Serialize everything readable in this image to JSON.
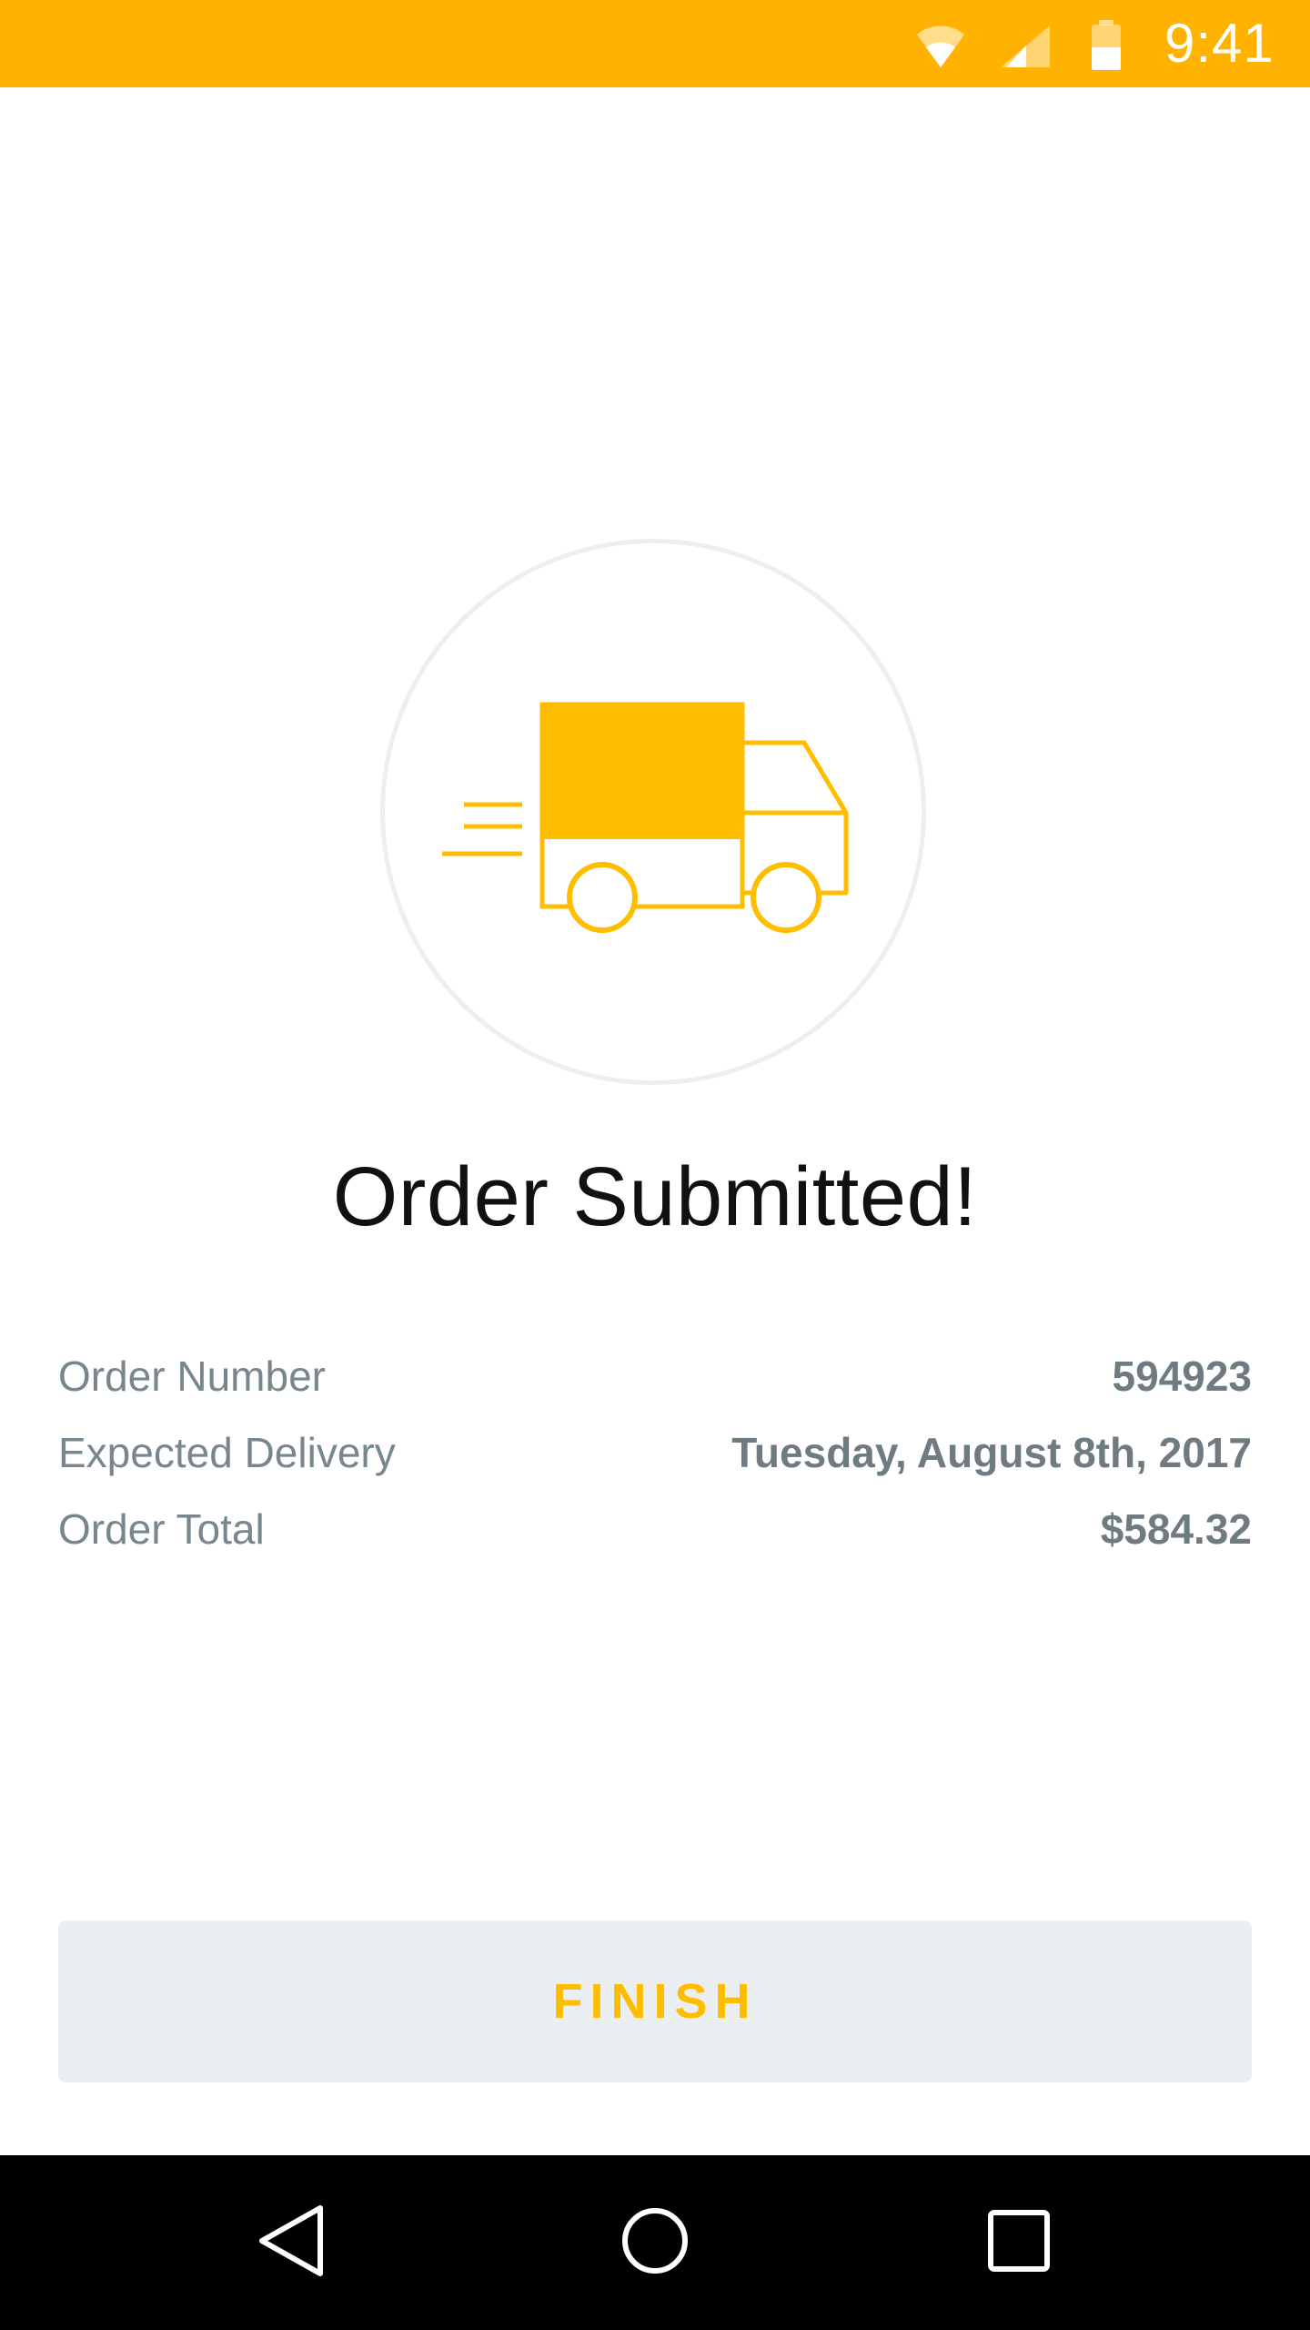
{
  "status_bar": {
    "time": "9:41",
    "background_color": "#FFB300",
    "icons": [
      "wifi-icon",
      "cellular-signal-icon",
      "battery-icon"
    ]
  },
  "hero": {
    "icon": "delivery-truck-icon",
    "accent_color": "#FFBD00"
  },
  "title": "Order Submitted!",
  "details": [
    {
      "label": "Order Number",
      "value": "594923"
    },
    {
      "label": "Expected Delivery",
      "value": "Tuesday, August 8th, 2017"
    },
    {
      "label": "Order Total",
      "value": "$584.32"
    }
  ],
  "finish_button": {
    "label": "FINISH"
  },
  "nav_bar": {
    "icons": [
      "back-icon",
      "home-icon",
      "recents-icon"
    ]
  }
}
